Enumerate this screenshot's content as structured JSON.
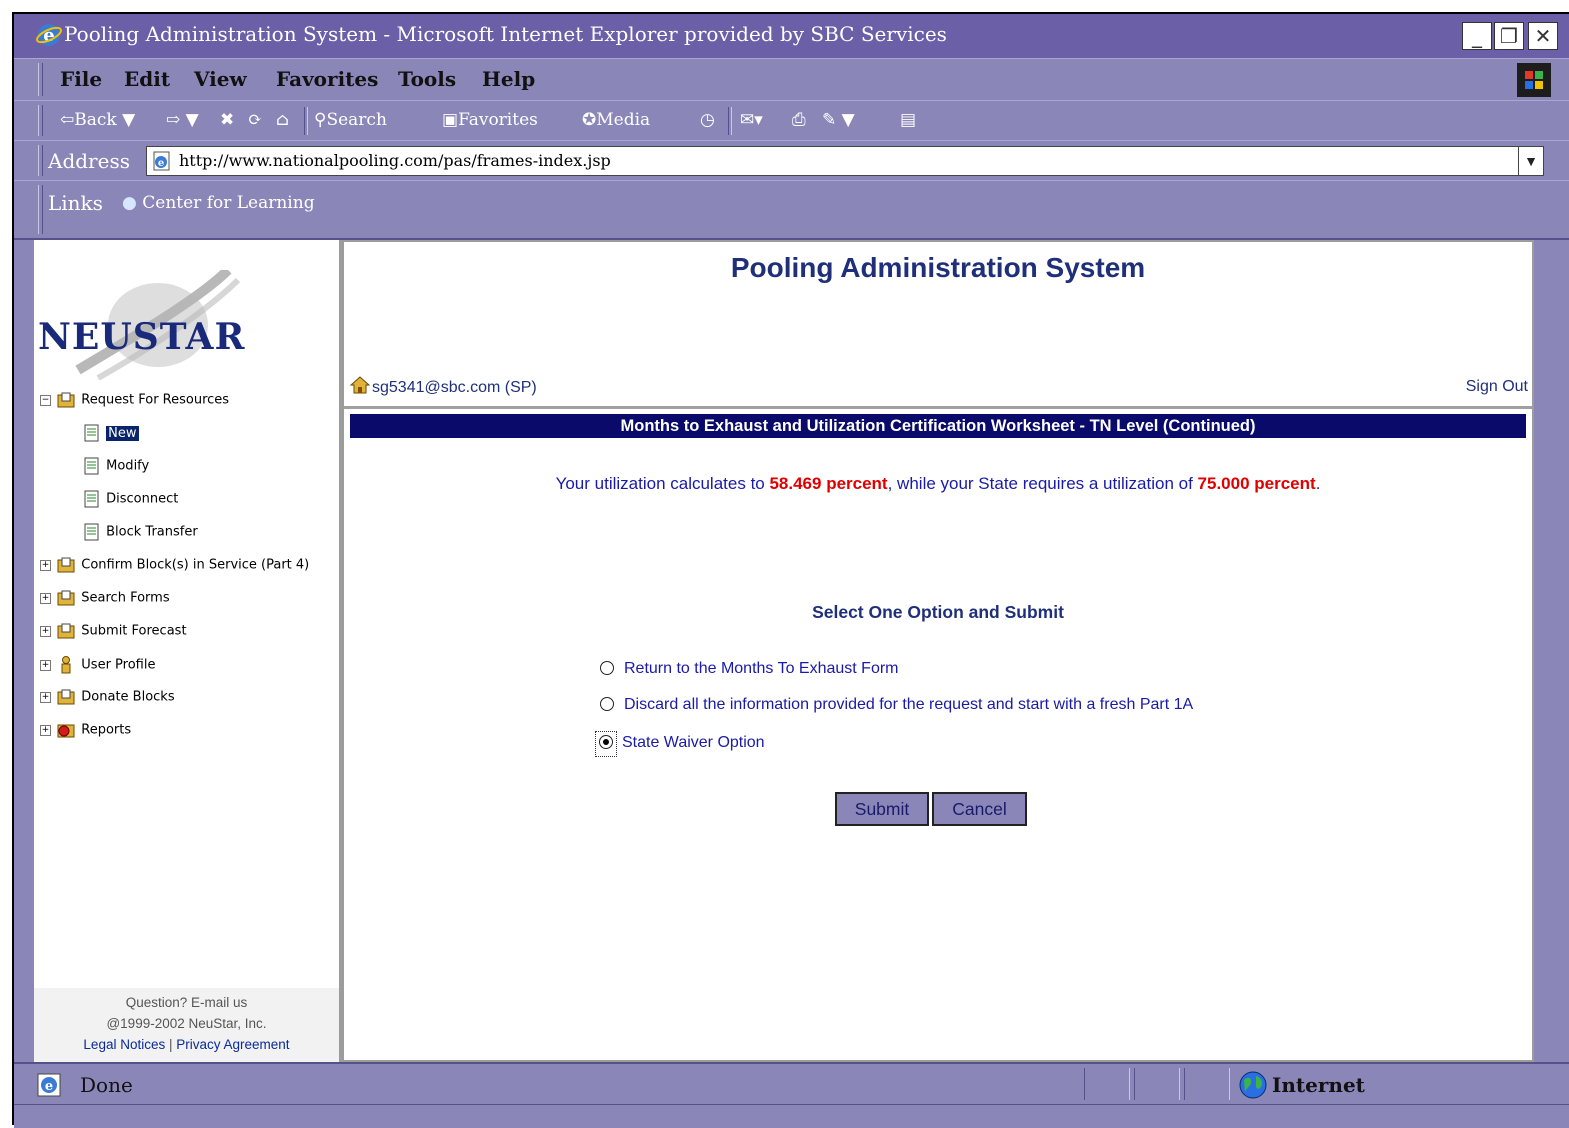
{
  "window": {
    "title": "Pooling Administration System - Microsoft Internet Explorer provided by SBC Services",
    "controls": {
      "minimize": "_",
      "maximize": "❐",
      "close": "✕"
    }
  },
  "menu": [
    "File",
    "Edit",
    "View",
    "Favorites",
    "Tools",
    "Help"
  ],
  "toolbar": {
    "back": "⇦Back ▼",
    "forward": "⇨ ▼",
    "stop": "✖",
    "refresh": "⟳",
    "home": "⌂",
    "search": "Search",
    "favorites": "Favorites",
    "media": "Media",
    "history": "◷",
    "mail": "✉▾",
    "print": "⎙",
    "edit": "✎ ▼",
    "discuss": "▤"
  },
  "address": {
    "label": "Address",
    "url": "http://www.nationalpooling.com/pas/frames-index.jsp",
    "dropdown": "▼"
  },
  "links": {
    "label": "Links",
    "item": "Center for Learning"
  },
  "sidebar": {
    "logo": "NEUSTAR",
    "tree": {
      "root": "Request For Resources",
      "children": [
        "New",
        "Modify",
        "Disconnect",
        "Block Transfer"
      ],
      "others": [
        "Confirm Block(s) in Service (Part 4)",
        "Search Forms",
        "Submit Forecast",
        "User Profile",
        "Donate Blocks",
        "Reports"
      ]
    },
    "footer": {
      "question": "Question? E-mail us",
      "copyright": "@1999-2002 NeuStar, Inc.",
      "legal": "Legal Notices",
      "sep": " | ",
      "privacy": "Privacy Agreement"
    }
  },
  "main": {
    "title": "Pooling Administration System",
    "user": "sg5341@sbc.com (SP)",
    "sign_out": "Sign Out",
    "worksheet_title": "Months to Exhaust and Utilization Certification Worksheet - TN Level (Continued)",
    "util": {
      "prefix": "Your utilization calculates to ",
      "value": "58.469 percent",
      "middle": ", while your State requires a utilization of ",
      "required": "75.000 percent",
      "suffix": "."
    },
    "select_title": "Select One Option and Submit",
    "options": [
      "Return to the Months To Exhaust Form",
      "Discard all the information provided for the request and start with a fresh Part 1A",
      "State Waiver Option"
    ],
    "submit": "Submit",
    "cancel": "Cancel"
  },
  "status": {
    "text": "Done",
    "zone": "Internet"
  }
}
